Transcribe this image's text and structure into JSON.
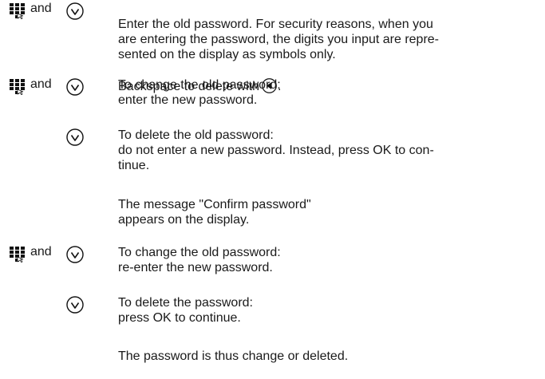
{
  "steps": [
    {
      "icons": "keypad-and-ok",
      "and_label": "and",
      "text": "Enter the old password. For security reasons, when you\nare entering the password, the digits you input are repre-\nsented on the display as symbols only.",
      "text2": "Backspace to delete with"
    },
    {
      "icons": "keypad-and-ok",
      "and_label": "and",
      "text": "To change the old password:\nenter the new password."
    },
    {
      "icons": "ok",
      "text": "To delete the old password:\ndo not enter a new password. Instead, press OK to con-\ntinue."
    },
    {
      "icons": "none",
      "text": "The message \"Confirm password\"\nappears on the display."
    },
    {
      "icons": "keypad-and-ok",
      "and_label": "and",
      "text": "To change the old password:\nre-enter the new password."
    },
    {
      "icons": "ok",
      "text": "To delete the password:\npress OK to continue."
    },
    {
      "icons": "none",
      "text": "The password is thus change or deleted."
    }
  ]
}
